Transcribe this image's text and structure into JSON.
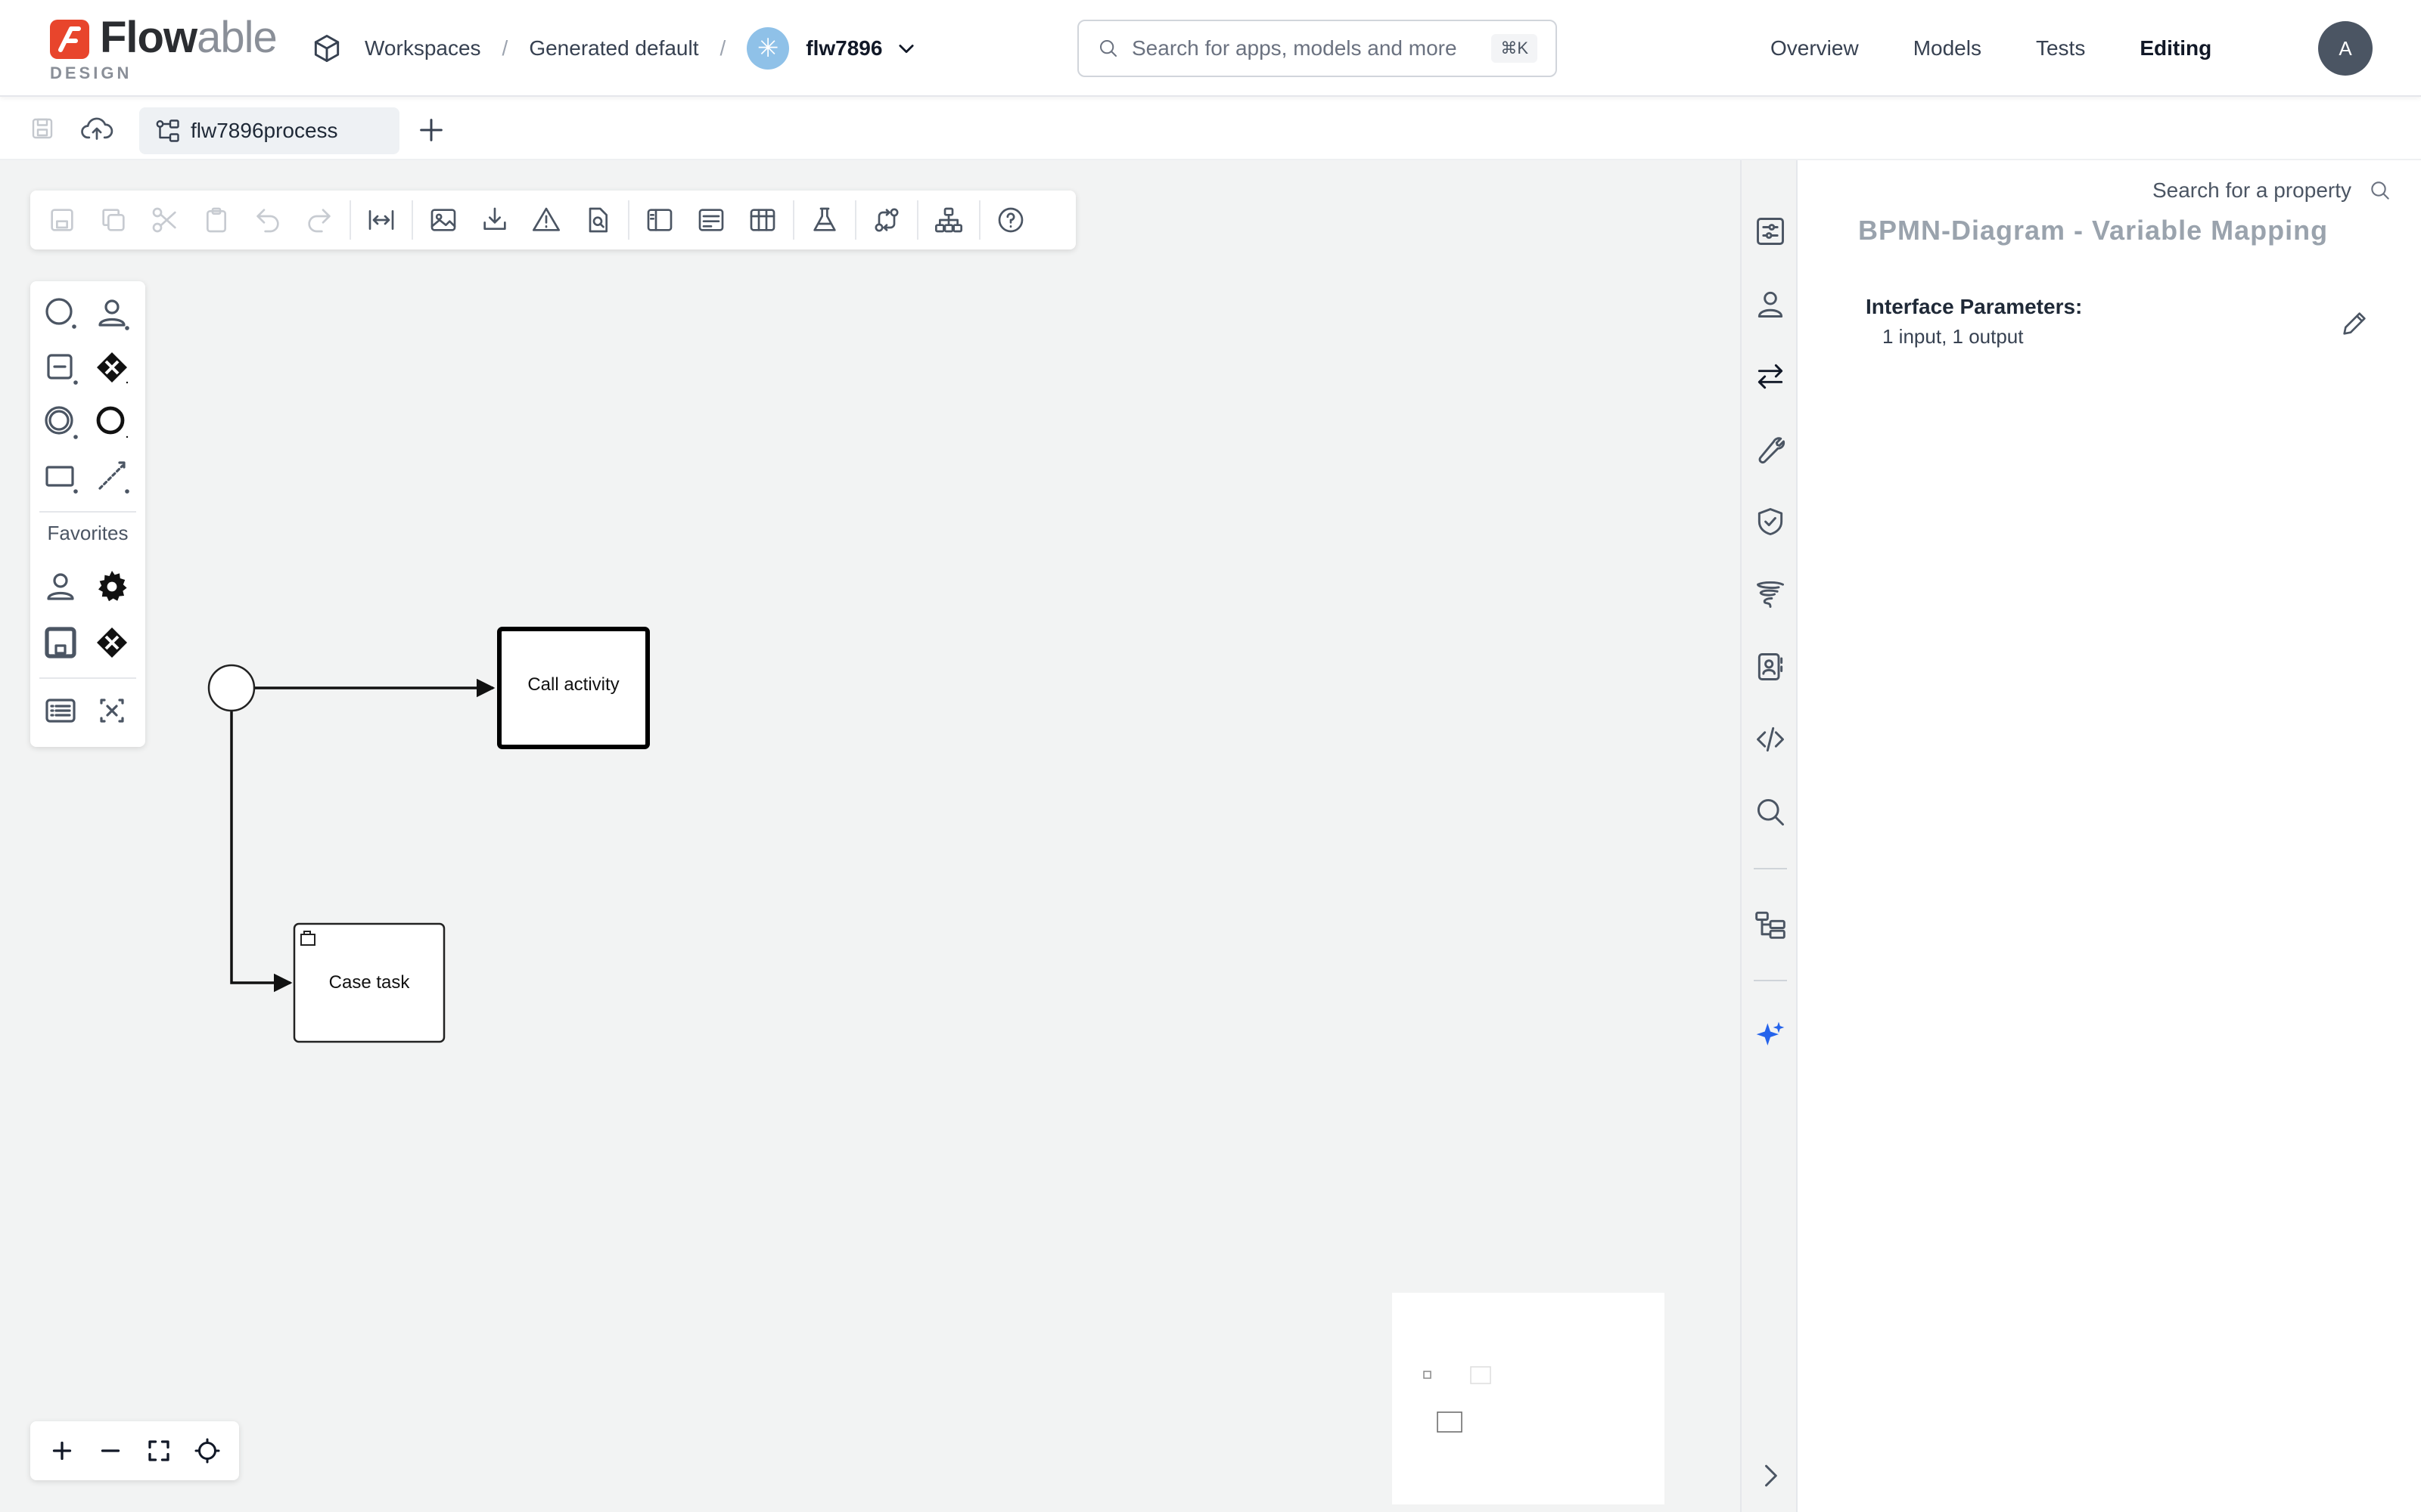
{
  "app": {
    "logo_word_dark": "Flow",
    "logo_word_light": "able",
    "logo_sub": "DESIGN",
    "brand_color": "#e8452c"
  },
  "breadcrumbs": {
    "workspaces": "Workspaces",
    "separator": "/",
    "generated_default": "Generated default",
    "project": "flw7896"
  },
  "search": {
    "placeholder": "Search for apps, models and more",
    "shortcut": "⌘K"
  },
  "nav": {
    "overview": "Overview",
    "models": "Models",
    "tests": "Tests",
    "editing": "Editing"
  },
  "user": {
    "initial": "A"
  },
  "tabs": {
    "active": "flw7896process"
  },
  "palette": {
    "favorites_label": "Favorites"
  },
  "diagram": {
    "nodes": {
      "call_activity": "Call activity",
      "case_task": "Case task"
    }
  },
  "properties": {
    "search_label": "Search for a property",
    "title": "BPMN-Diagram - Variable Mapping",
    "interface_label": "Interface Parameters:",
    "interface_value": "1 input, 1 output"
  },
  "colors": {
    "canvas_bg": "#f2f3f3",
    "ai_accent": "#2563eb",
    "title_muted": "#9aa3ad"
  }
}
